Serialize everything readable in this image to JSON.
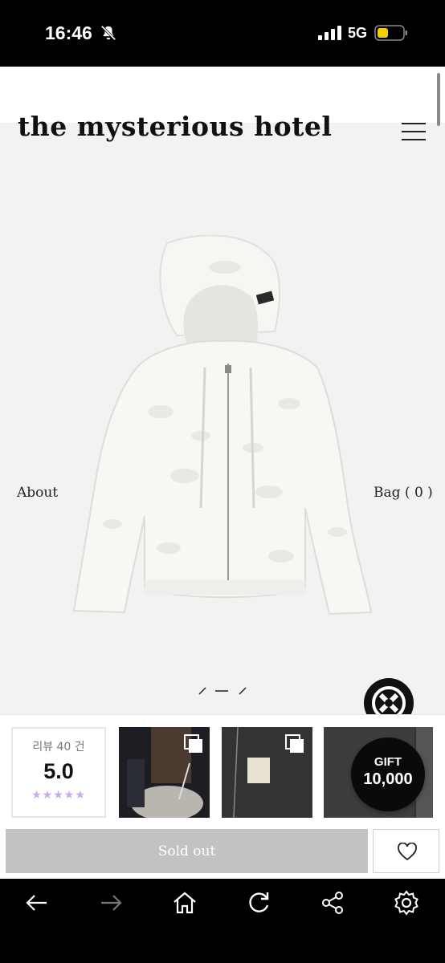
{
  "status_bar": {
    "time": "16:46",
    "network": "5G",
    "battery_color": "#f5d000"
  },
  "site": {
    "logo": "the mysterious hotel",
    "nav_left": "About",
    "nav_right": "Bag ( 0 )"
  },
  "reviews": {
    "label": "리뷰 40 건",
    "score": "5.0",
    "stars": "★★★★★",
    "star_color": "#c9a9ec"
  },
  "gift": {
    "title": "GIFT",
    "amount": "10,000"
  },
  "purchase": {
    "sold_out_label": "Sold out",
    "button_color": "#c2c2c2"
  },
  "icons": {
    "status": [
      "bell-off-icon",
      "signal-icon",
      "battery-icon"
    ],
    "toolbar": [
      "back-arrow-icon",
      "forward-arrow-icon",
      "home-icon",
      "refresh-icon",
      "share-icon",
      "settings-icon"
    ],
    "other": [
      "menu-icon",
      "heart-icon",
      "brand-logo-icon",
      "multi-image-icon"
    ]
  }
}
